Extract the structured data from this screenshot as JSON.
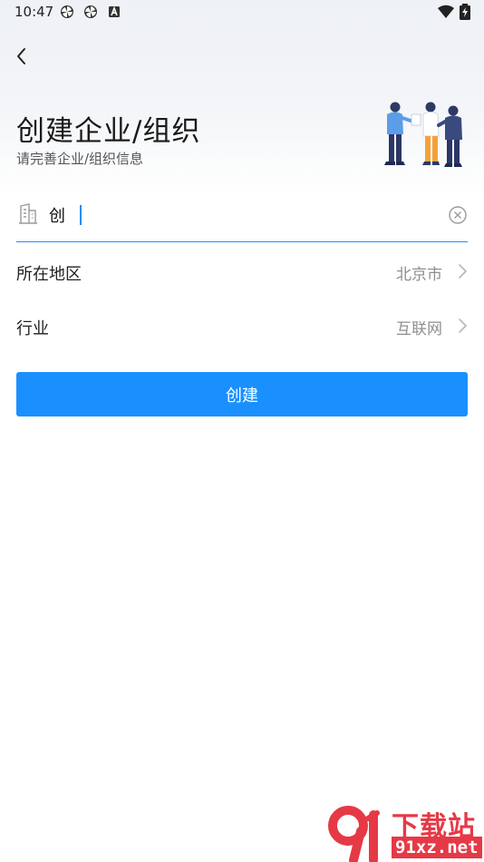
{
  "status_bar": {
    "time": "10:47",
    "left_icons": [
      "pinwheel-icon",
      "pinwheel-icon",
      "app-a-icon"
    ],
    "right_icons": [
      "wifi-icon",
      "battery-charging-icon"
    ]
  },
  "nav": {
    "back_icon": "chevron-left-icon"
  },
  "header": {
    "title": "创建企业/组织",
    "subtitle": "请完善企业/组织信息",
    "illustration": "team-people-illustration"
  },
  "form": {
    "name_input": {
      "value": "创",
      "prefix_icon": "building-icon",
      "clear_icon": "clear-circle-icon"
    },
    "region": {
      "label": "所在地区",
      "value": "北京市"
    },
    "industry": {
      "label": "行业",
      "value": "互联网"
    },
    "submit_label": "创建"
  },
  "watermark": {
    "title": "下载站",
    "url": "91xz.net"
  },
  "colors": {
    "accent": "#1a90ff",
    "input_underline": "#1e8ef5",
    "watermark": "#e63946"
  }
}
